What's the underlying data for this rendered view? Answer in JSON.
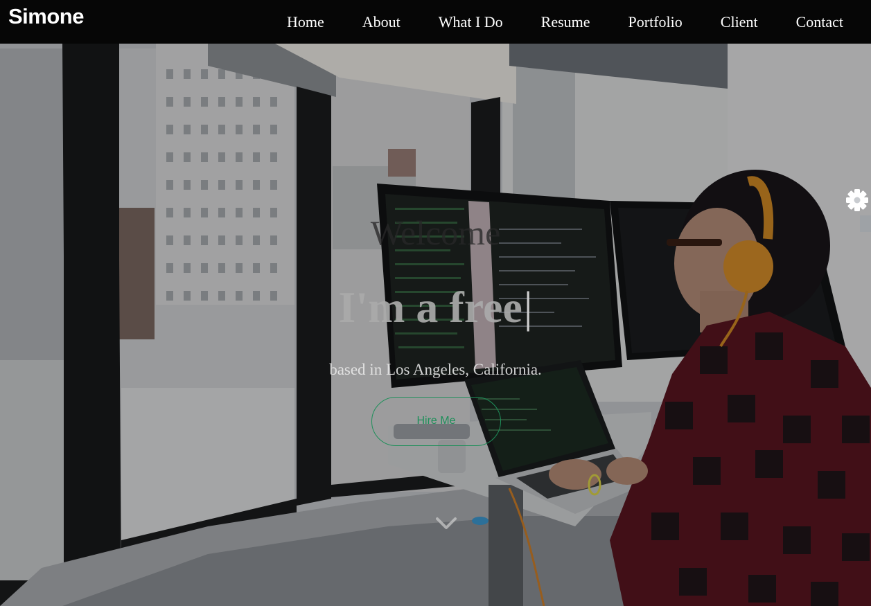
{
  "brand": {
    "name": "Simone"
  },
  "nav": {
    "items": [
      {
        "label": "Home"
      },
      {
        "label": "About"
      },
      {
        "label": "What I Do"
      },
      {
        "label": "Resume"
      },
      {
        "label": "Portfolio"
      },
      {
        "label": "Client"
      },
      {
        "label": "Contact"
      }
    ]
  },
  "hero": {
    "welcome": "Welcome",
    "headline": "I'm a free",
    "caret": "|",
    "location": "based in Los Angeles, California.",
    "cta_label": "Hire Me",
    "scroll_icon": "chevron-down-icon"
  },
  "settings": {
    "icon": "gear-icon"
  },
  "colors": {
    "navbar_bg": "#060606",
    "accent": "#1e8f5a",
    "text_light": "#ffffff"
  }
}
